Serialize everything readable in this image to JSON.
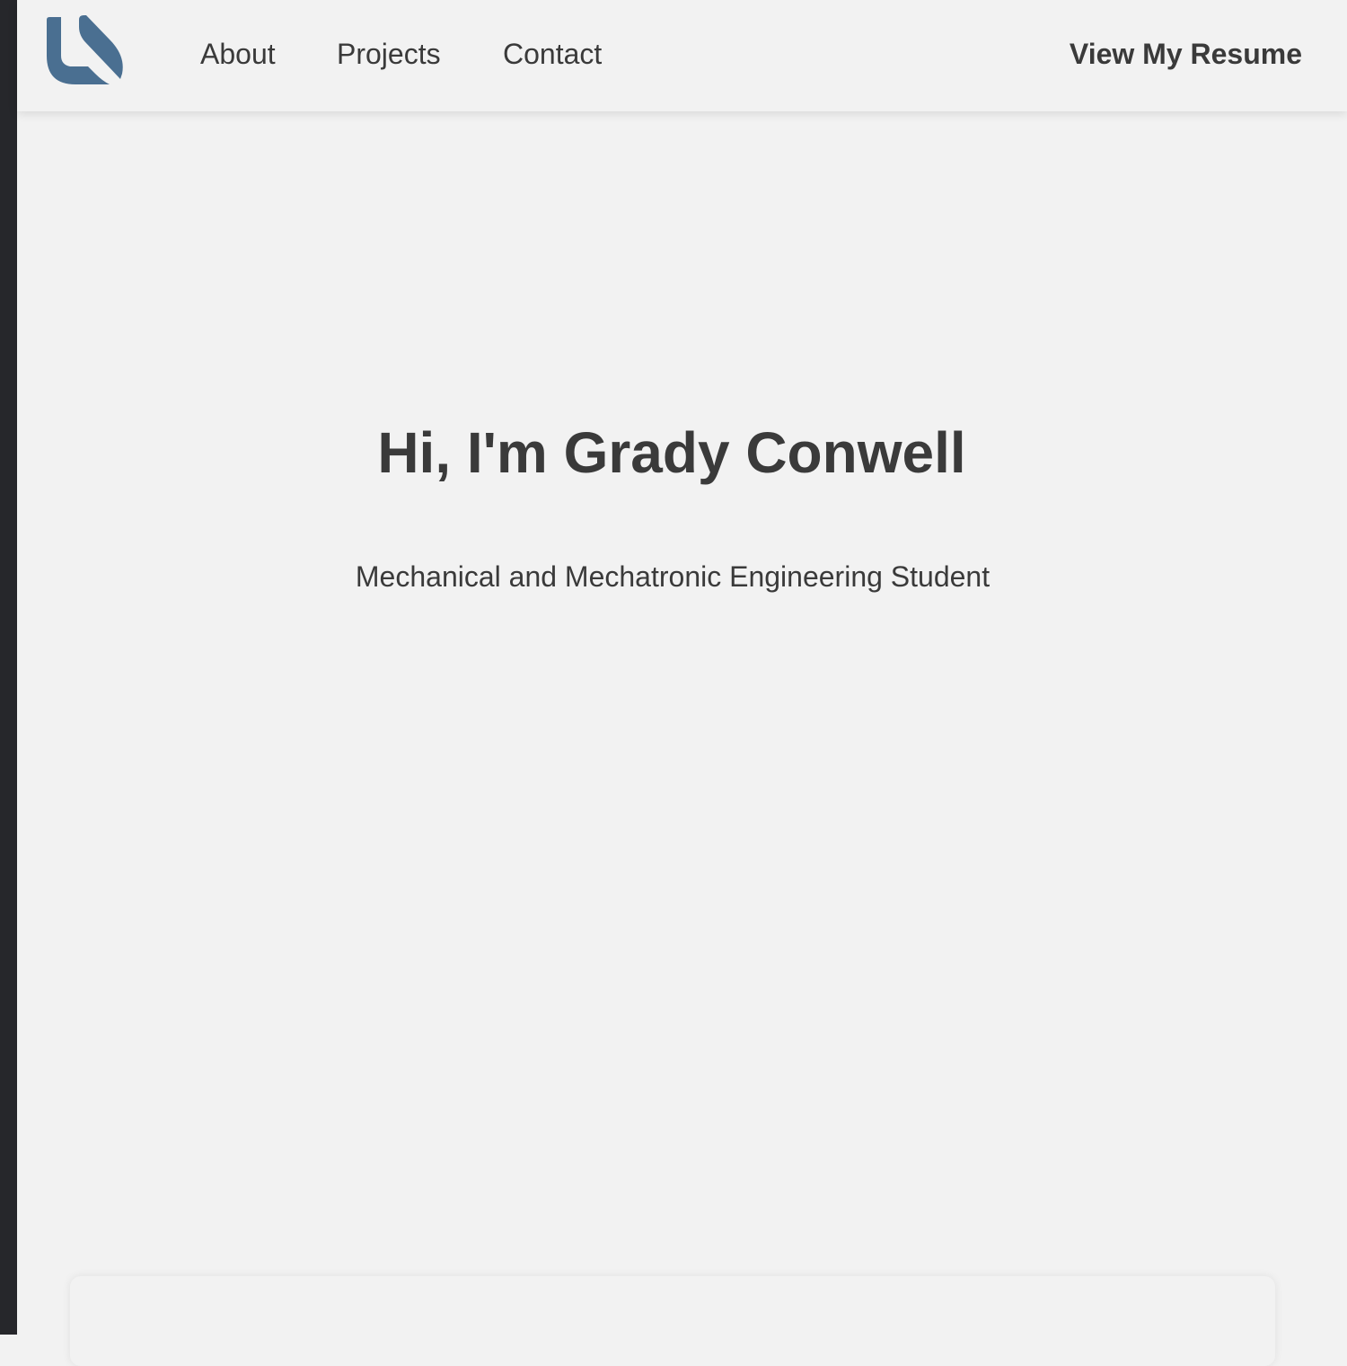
{
  "nav": {
    "logo_name": "logo-icon",
    "links": [
      {
        "label": "About"
      },
      {
        "label": "Projects"
      },
      {
        "label": "Contact"
      }
    ],
    "resume_label": "View My Resume"
  },
  "hero": {
    "title": "Hi, I'm Grady Conwell",
    "subtitle": "Mechanical and Mechatronic Engineering Student"
  },
  "colors": {
    "background": "#f2f2f2",
    "text": "#3a3a3a",
    "logo_accent": "#4a6f91",
    "side_strip": "#26272b"
  }
}
